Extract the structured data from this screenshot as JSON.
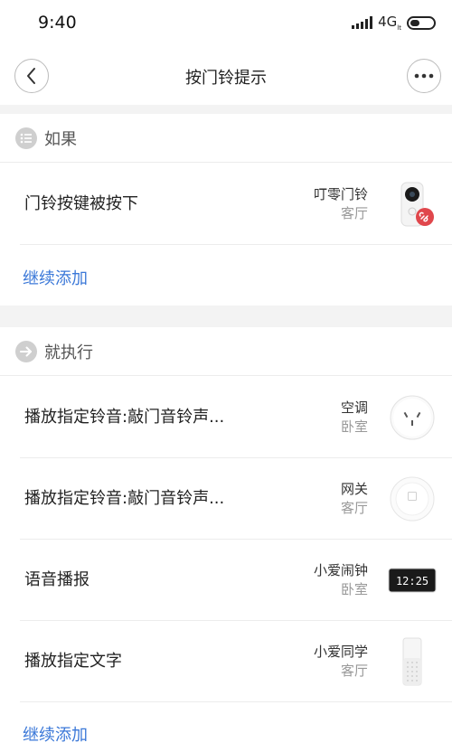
{
  "status_bar": {
    "time": "9:40",
    "network": "4G",
    "network_sub": "lt"
  },
  "nav": {
    "title": "按门铃提示"
  },
  "if_section": {
    "title": "如果",
    "items": [
      {
        "label": "门铃按键被按下",
        "device": "叮零门铃",
        "room": "客厅",
        "icon": "doorbell-camera"
      }
    ],
    "add_label": "继续添加"
  },
  "then_section": {
    "title": "就执行",
    "items": [
      {
        "label": "播放指定铃音:敲门音铃声...",
        "device": "空调",
        "room": "卧室",
        "icon": "ac-companion-plug"
      },
      {
        "label": "播放指定铃音:敲门音铃声...",
        "device": "网关",
        "room": "客厅",
        "icon": "gateway"
      },
      {
        "label": "语音播报",
        "device": "小爱闹钟",
        "room": "卧室",
        "icon": "alarm-clock",
        "clock_text": "12:25"
      },
      {
        "label": "播放指定文字",
        "device": "小爱同学",
        "room": "客厅",
        "icon": "smart-speaker"
      }
    ],
    "add_label": "继续添加"
  }
}
